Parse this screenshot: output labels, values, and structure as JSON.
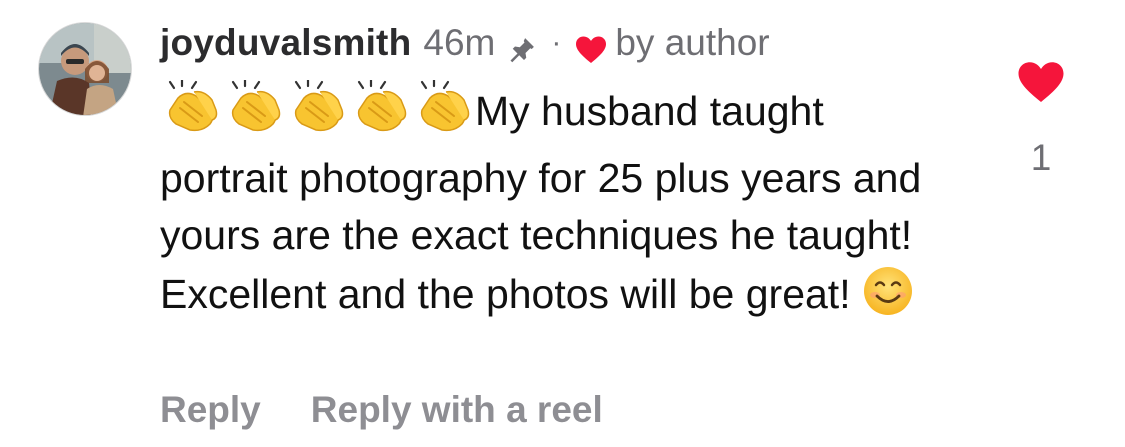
{
  "comment": {
    "username": "joyduvalsmith",
    "time_ago": "46m",
    "separator": "·",
    "author_label": "by author",
    "icons": {
      "avatar": "profile-photo",
      "pin": "pin-icon",
      "author_like": "heart-icon",
      "clap_emoji": "clapping-hands-emoji",
      "smile_emoji": "smiling-face-emoji"
    },
    "clap_emoji_count": 5,
    "text_main": "My husband taught portrait photography for 25 plus years and yours are the exact techniques he taught! Excellent and the photos will be great!",
    "like_count": "1",
    "colors": {
      "heart": "#f5153b",
      "meta_gray": "#6e6e73",
      "action_gray": "#8e8e93"
    }
  },
  "actions": {
    "reply_label": "Reply",
    "reply_reel_label": "Reply with a reel"
  }
}
